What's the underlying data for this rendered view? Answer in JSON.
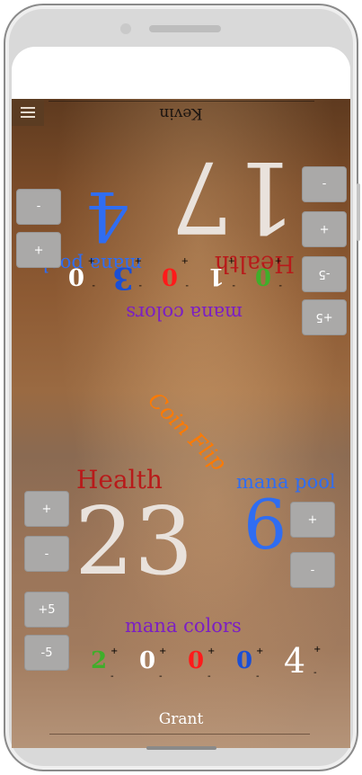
{
  "top_player": {
    "name": "Kevin",
    "health": "17",
    "health_label": "Health",
    "mana_pool": "4",
    "mana_pool_label": "mana pool",
    "mana_colors_label": "mana colors",
    "health_buttons": [
      "+5",
      "-5",
      "+",
      "-"
    ],
    "pool_buttons": [
      "+",
      "-"
    ],
    "mana": [
      {
        "value": "0",
        "color": "#3fae2a"
      },
      {
        "value": "1",
        "color": "#ffffff"
      },
      {
        "value": "0",
        "color": "#ff1a1a"
      },
      {
        "value": "3",
        "color": "#1a4fd6"
      },
      {
        "value": "0",
        "color": "#ffffff"
      }
    ]
  },
  "bottom_player": {
    "name": "Grant",
    "health": "23",
    "health_label": "Health",
    "mana_pool": "6",
    "mana_pool_label": "mana pool",
    "mana_colors_label": "mana colors",
    "health_buttons": [
      "+",
      "-",
      "+5",
      "-5"
    ],
    "pool_buttons": [
      "+",
      "-"
    ],
    "mana": [
      {
        "value": "2",
        "color": "#3fae2a"
      },
      {
        "value": "0",
        "color": "#ffffff"
      },
      {
        "value": "0",
        "color": "#ff1a1a"
      },
      {
        "value": "0",
        "color": "#1a4fd6"
      },
      {
        "value": "4",
        "color": "#ffffff"
      }
    ]
  },
  "coin_flip_label": "Coin Flip",
  "mana_plus": "+",
  "mana_minus": "-",
  "colors": {
    "health": "#b81a1a",
    "mana_pool": "#2f6df2",
    "mana_colors": "#7b1fc4",
    "coin_flip": "#ff7a00",
    "health_number": "#e9e2dc"
  }
}
